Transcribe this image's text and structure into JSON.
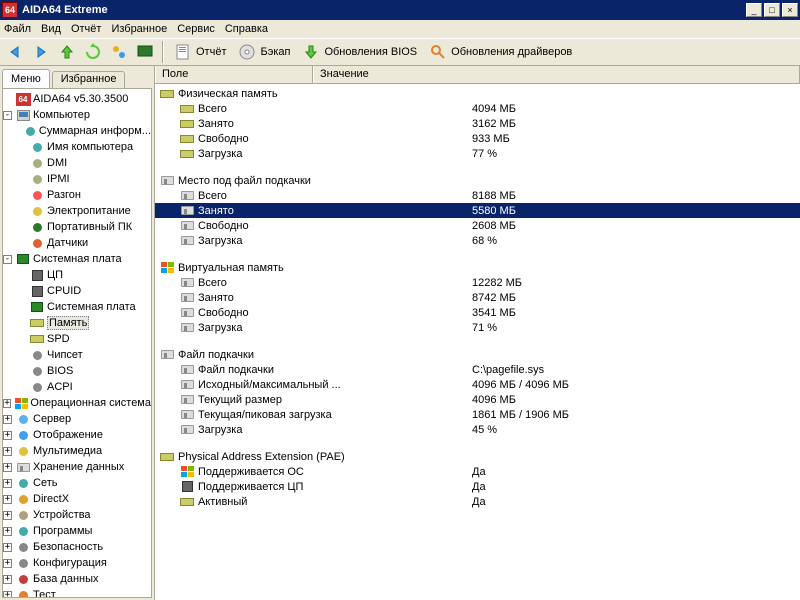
{
  "title": "AIDA64 Extreme",
  "app_icon_text": "64",
  "menubar": [
    "Файл",
    "Вид",
    "Отчёт",
    "Избранное",
    "Сервис",
    "Справка"
  ],
  "toolbar": {
    "report": "Отчёт",
    "backup": "Бэкап",
    "bios_update": "Обновления BIOS",
    "driver_update": "Обновления драйверов"
  },
  "tabs": {
    "menu": "Меню",
    "favorites": "Избранное"
  },
  "root_node": "AIDA64 v5.30.3500",
  "tree": {
    "computer": {
      "label": "Компьютер",
      "children": [
        "Суммарная информ...",
        "Имя компьютера",
        "DMI",
        "IPMI",
        "Разгон",
        "Электропитание",
        "Портативный ПК",
        "Датчики"
      ]
    },
    "motherboard": {
      "label": "Системная плата",
      "children": [
        "ЦП",
        "CPUID",
        "Системная плата",
        "Память",
        "SPD",
        "Чипсет",
        "BIOS",
        "ACPI"
      ]
    },
    "os": "Операционная система",
    "server": "Сервер",
    "display": "Отображение",
    "multimedia": "Мультимедиа",
    "storage": "Хранение данных",
    "network": "Сеть",
    "directx": "DirectX",
    "devices": "Устройства",
    "programs": "Программы",
    "security": "Безопасность",
    "config": "Конфигурация",
    "database": "База данных",
    "test": "Тест"
  },
  "selected_tree_item": "Память",
  "columns": {
    "field": "Поле",
    "value": "Значение"
  },
  "groups": [
    {
      "icon": "ram",
      "title": "Физическая память",
      "rows": [
        {
          "icon": "ram",
          "field": "Всего",
          "value": "4094 МБ"
        },
        {
          "icon": "ram",
          "field": "Занято",
          "value": "3162 МБ"
        },
        {
          "icon": "ram",
          "field": "Свободно",
          "value": "933 МБ"
        },
        {
          "icon": "ram",
          "field": "Загрузка",
          "value": "77 %"
        }
      ]
    },
    {
      "icon": "drive",
      "title": "Место под файл подкачки",
      "rows": [
        {
          "icon": "drive",
          "field": "Всего",
          "value": "8188 МБ"
        },
        {
          "icon": "drive",
          "field": "Занято",
          "value": "5580 МБ",
          "selected": true
        },
        {
          "icon": "drive",
          "field": "Свободно",
          "value": "2608 МБ"
        },
        {
          "icon": "drive",
          "field": "Загрузка",
          "value": "68 %"
        }
      ]
    },
    {
      "icon": "win",
      "title": "Виртуальная память",
      "rows": [
        {
          "icon": "drive",
          "field": "Всего",
          "value": "12282 МБ"
        },
        {
          "icon": "drive",
          "field": "Занято",
          "value": "8742 МБ"
        },
        {
          "icon": "drive",
          "field": "Свободно",
          "value": "3541 МБ"
        },
        {
          "icon": "drive",
          "field": "Загрузка",
          "value": "71 %"
        }
      ]
    },
    {
      "icon": "drive",
      "title": "Файл подкачки",
      "rows": [
        {
          "icon": "drive",
          "field": "Файл подкачки",
          "value": "C:\\pagefile.sys"
        },
        {
          "icon": "drive",
          "field": "Исходный/максимальный ...",
          "value": "4096 МБ / 4096 МБ"
        },
        {
          "icon": "drive",
          "field": "Текущий размер",
          "value": "4096 МБ"
        },
        {
          "icon": "drive",
          "field": "Текущая/пиковая загрузка",
          "value": "1861 МБ / 1906 МБ"
        },
        {
          "icon": "drive",
          "field": "Загрузка",
          "value": "45 %"
        }
      ]
    },
    {
      "icon": "ram",
      "title": "Physical Address Extension (PAE)",
      "rows": [
        {
          "icon": "win",
          "field": "Поддерживается ОС",
          "value": "Да"
        },
        {
          "icon": "cpu",
          "field": "Поддерживается ЦП",
          "value": "Да"
        },
        {
          "icon": "ram",
          "field": "Активный",
          "value": "Да"
        }
      ]
    }
  ]
}
